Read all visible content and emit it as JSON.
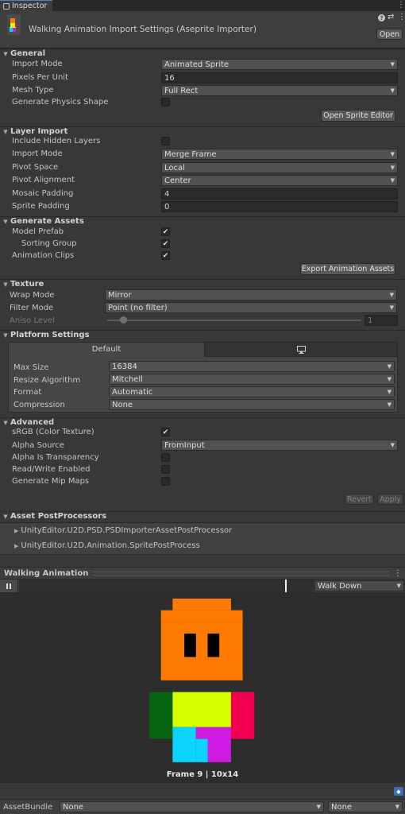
{
  "tab": {
    "label": "Inspector"
  },
  "header": {
    "title": "Walking Animation Import Settings (Aseprite Importer)",
    "open_label": "Open"
  },
  "general": {
    "title": "General",
    "import_mode": {
      "label": "Import Mode",
      "value": "Animated Sprite"
    },
    "pixels_per_unit": {
      "label": "Pixels Per Unit",
      "value": "16"
    },
    "mesh_type": {
      "label": "Mesh Type",
      "value": "Full Rect"
    },
    "physics_shape": {
      "label": "Generate Physics Shape",
      "checked": false
    },
    "open_sprite_editor": "Open Sprite Editor"
  },
  "layer_import": {
    "title": "Layer Import",
    "include_hidden": {
      "label": "Include Hidden Layers",
      "checked": false
    },
    "import_mode": {
      "label": "Import Mode",
      "value": "Merge Frame"
    },
    "pivot_space": {
      "label": "Pivot Space",
      "value": "Local"
    },
    "pivot_alignment": {
      "label": "Pivot Alignment",
      "value": "Center"
    },
    "mosaic_padding": {
      "label": "Mosaic Padding",
      "value": "4"
    },
    "sprite_padding": {
      "label": "Sprite Padding",
      "value": "0"
    }
  },
  "generate_assets": {
    "title": "Generate Assets",
    "model_prefab": {
      "label": "Model Prefab",
      "checked": true
    },
    "sorting_group": {
      "label": "Sorting Group",
      "checked": true
    },
    "animation_clips": {
      "label": "Animation Clips",
      "checked": true
    },
    "export_label": "Export Animation Assets"
  },
  "texture": {
    "title": "Texture",
    "wrap_mode": {
      "label": "Wrap Mode",
      "value": "Mirror"
    },
    "filter_mode": {
      "label": "Filter Mode",
      "value": "Point (no filter)"
    },
    "aniso_level": {
      "label": "Aniso Level",
      "value": "1"
    }
  },
  "platform": {
    "title": "Platform Settings",
    "tab_default": "Default",
    "monitor_icon": "monitor-icon",
    "max_size": {
      "label": "Max Size",
      "value": "16384"
    },
    "resize_algorithm": {
      "label": "Resize Algorithm",
      "value": "Mitchell"
    },
    "format": {
      "label": "Format",
      "value": "Automatic"
    },
    "compression": {
      "label": "Compression",
      "value": "None"
    }
  },
  "advanced": {
    "title": "Advanced",
    "srgb": {
      "label": "sRGB (Color Texture)",
      "checked": true
    },
    "alpha_source": {
      "label": "Alpha Source",
      "value": "FromInput"
    },
    "alpha_is_transparency": {
      "label": "Alpha Is Transparency",
      "checked": false
    },
    "read_write": {
      "label": "Read/Write Enabled",
      "checked": false
    },
    "mip_maps": {
      "label": "Generate Mip Maps",
      "checked": false
    }
  },
  "actions": {
    "revert": "Revert",
    "apply": "Apply"
  },
  "postprocessors": {
    "title": "Asset PostProcessors",
    "items": [
      "UnityEditor.U2D.PSD.PSDImporterAssetPostProcessor",
      "UnityEditor.U2D.Animation.SpritePostProcess"
    ]
  },
  "preview": {
    "title": "Walking Animation",
    "clip": "Walk Down",
    "caption": "Frame 9 | 10x14",
    "colors": {
      "head": "#ff7b00",
      "eye": "#000000",
      "body": "#d4ff00",
      "arm_left": "#056311",
      "arm_right": "#f2004f",
      "leg_left": "#0ad4ff",
      "leg_right": "#d11be5"
    }
  },
  "asset_bundle": {
    "label": "AssetBundle",
    "name": "None",
    "variant": "None"
  }
}
